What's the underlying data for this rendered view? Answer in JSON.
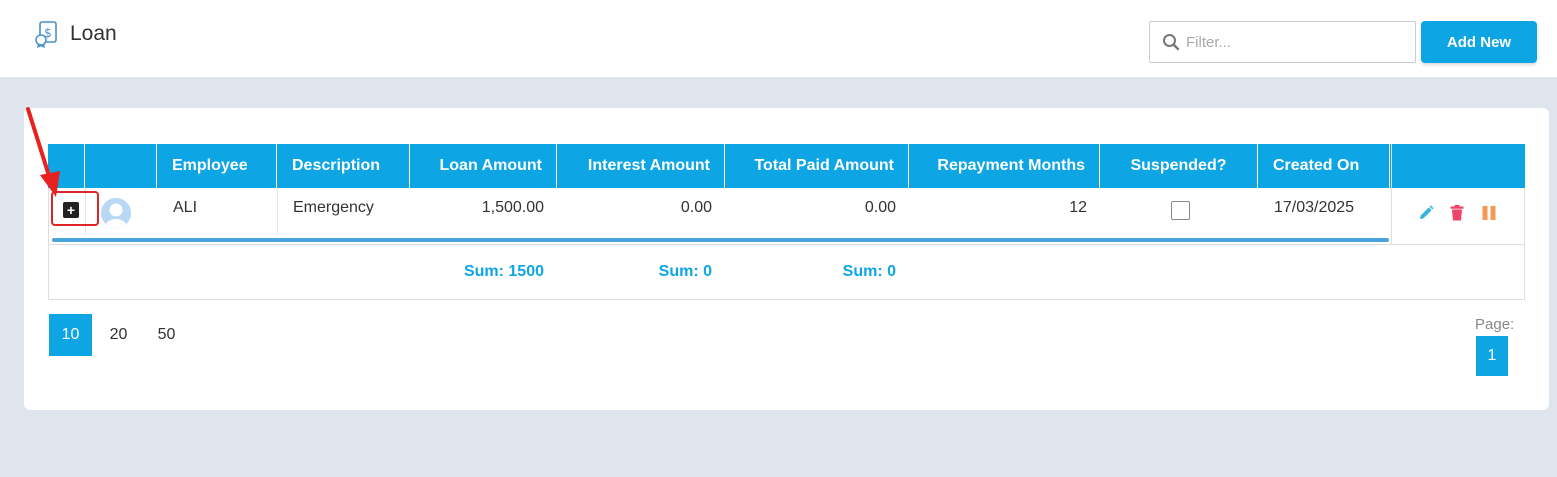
{
  "header": {
    "title": "Loan",
    "filter_placeholder": "Filter...",
    "add_label": "Add New"
  },
  "table": {
    "columns": [
      "Employee",
      "Description",
      "Loan Amount",
      "Interest Amount",
      "Total Paid Amount",
      "Repayment Months",
      "Suspended?",
      "Created On"
    ],
    "rows": [
      {
        "employee": "ALI",
        "description": "Emergency",
        "loan_amount": "1,500.00",
        "interest_amount": "0.00",
        "total_paid_amount": "0.00",
        "repayment_months": "12",
        "suspended": false,
        "created_on": "17/03/2025"
      }
    ],
    "sums": {
      "loan_amount": "Sum: 1500",
      "interest_amount": "Sum: 0",
      "total_paid_amount": "Sum: 0"
    }
  },
  "pager": {
    "sizes": [
      "10",
      "20",
      "50"
    ],
    "active_size": "10",
    "page_label": "Page:",
    "current_page": "1"
  },
  "colors": {
    "accent": "#0ea5e5",
    "delete": "#f0436a",
    "pause": "#f59a56",
    "highlight": "#e02424"
  },
  "icons": [
    "loan-icon",
    "search-icon",
    "expand-icon",
    "avatar",
    "edit-icon",
    "delete-icon",
    "pause-icon",
    "arrow-annotation"
  ]
}
